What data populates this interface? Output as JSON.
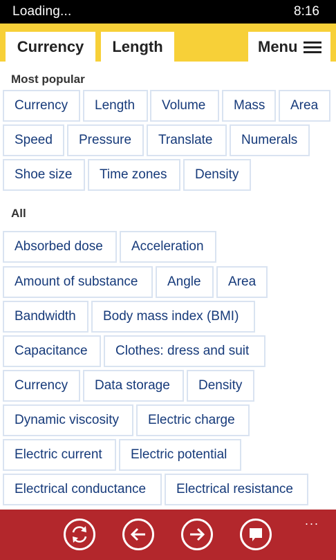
{
  "status": {
    "left": "Loading...",
    "time": "8:16"
  },
  "tabs": {
    "currency": "Currency",
    "length": "Length",
    "menu": "Menu"
  },
  "sections": {
    "popular": "Most popular",
    "all": "All"
  },
  "popular": [
    "Currency",
    "Length",
    "Volume",
    "Mass",
    "Area",
    "Speed",
    "Pressure",
    "Translate",
    "Numerals",
    "Shoe size",
    "Time zones",
    "Density"
  ],
  "all": [
    "Absorbed dose",
    "Acceleration",
    "Amount of substance",
    "Angle",
    "Area",
    "Bandwidth",
    "Body mass index (BMI)",
    "Capacitance",
    "Clothes: dress and suit",
    "Currency",
    "Data storage",
    "Density",
    "Dynamic viscosity",
    "Electric charge",
    "Electric current",
    "Electric potential",
    "Electrical conductance",
    "Electrical resistance"
  ],
  "appbar": {
    "icons": [
      "refresh-icon",
      "back-icon",
      "forward-icon",
      "feedback-icon"
    ],
    "more": "..."
  },
  "colors": {
    "accent": "#f7d038",
    "appbar": "#b3272c",
    "chip_text": "#163a7a",
    "chip_border": "#d9e3f1"
  }
}
